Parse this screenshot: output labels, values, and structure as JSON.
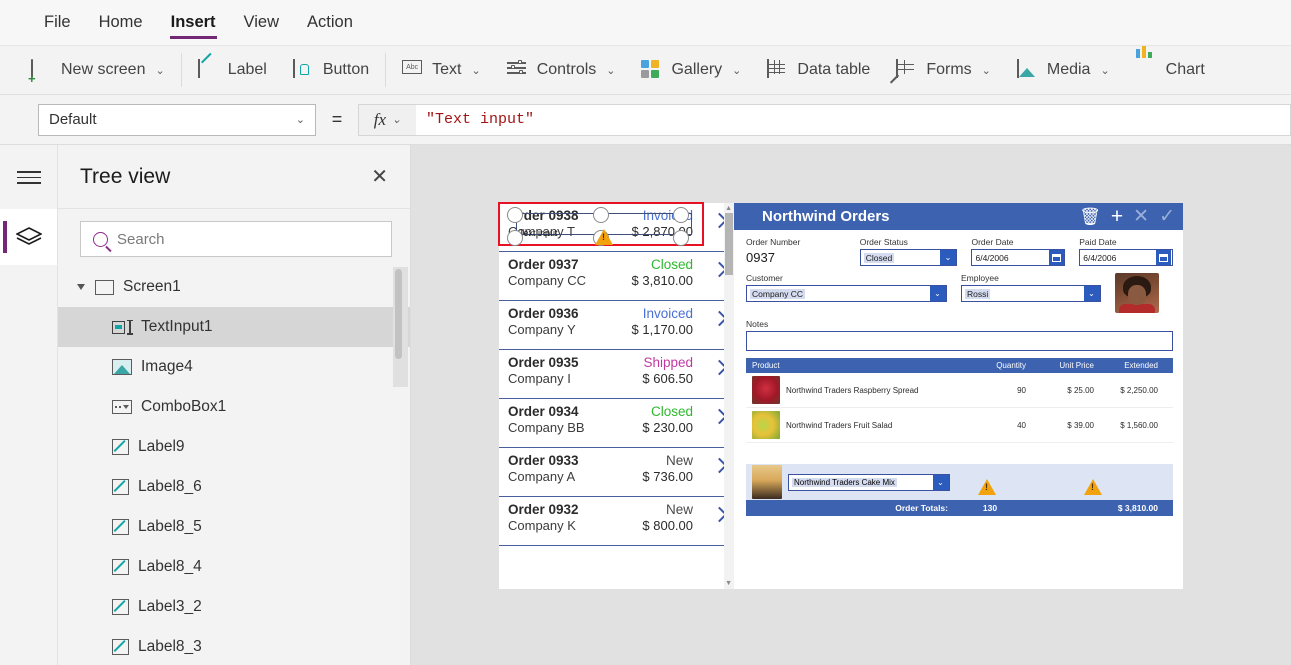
{
  "menu": {
    "tabs": [
      {
        "label": "File",
        "active": false
      },
      {
        "label": "Home",
        "active": false
      },
      {
        "label": "Insert",
        "active": true
      },
      {
        "label": "View",
        "active": false
      },
      {
        "label": "Action",
        "active": false
      }
    ]
  },
  "ribbon": {
    "items": [
      {
        "label": "New screen",
        "icon": "new-screen-icon",
        "caret": true
      },
      {
        "label": "Label",
        "icon": "label-icon",
        "caret": false
      },
      {
        "label": "Button",
        "icon": "button-icon",
        "caret": false
      },
      {
        "label": "Text",
        "icon": "text-icon",
        "caret": true
      },
      {
        "label": "Controls",
        "icon": "controls-icon",
        "caret": true
      },
      {
        "label": "Gallery",
        "icon": "gallery-icon",
        "caret": true
      },
      {
        "label": "Data table",
        "icon": "data-table-icon",
        "caret": false
      },
      {
        "label": "Forms",
        "icon": "forms-icon",
        "caret": true
      },
      {
        "label": "Media",
        "icon": "media-icon",
        "caret": true
      },
      {
        "label": "Chart",
        "icon": "chart-icon",
        "caret": false
      }
    ]
  },
  "propertybar": {
    "property": "Default",
    "equals": "=",
    "fx": "fx",
    "formula": "\"Text input\""
  },
  "treeview": {
    "title": "Tree view",
    "close_icon": "✕",
    "search_placeholder": "Search",
    "items": [
      {
        "label": "Screen1",
        "level": 0,
        "icon": "screen-icon",
        "selected": false
      },
      {
        "label": "TextInput1",
        "level": 1,
        "icon": "text-input-icon",
        "selected": true
      },
      {
        "label": "Image4",
        "level": 1,
        "icon": "image-icon",
        "selected": false
      },
      {
        "label": "ComboBox1",
        "level": 1,
        "icon": "combobox-icon",
        "selected": false
      },
      {
        "label": "Label9",
        "level": 1,
        "icon": "label-icon",
        "selected": false
      },
      {
        "label": "Label8_6",
        "level": 1,
        "icon": "label-icon",
        "selected": false
      },
      {
        "label": "Label8_5",
        "level": 1,
        "icon": "label-icon",
        "selected": false
      },
      {
        "label": "Label8_4",
        "level": 1,
        "icon": "label-icon",
        "selected": false
      },
      {
        "label": "Label3_2",
        "level": 1,
        "icon": "label-icon",
        "selected": false
      },
      {
        "label": "Label8_3",
        "level": 1,
        "icon": "label-icon",
        "selected": false
      }
    ]
  },
  "canvas": {
    "selection_label": "Text input",
    "gallery": [
      {
        "order": "Order 0938",
        "company": "Company T",
        "status": "Invoiced",
        "status_color": "#4a6fd4",
        "amount": "$ 2,870.00"
      },
      {
        "order": "Order 0937",
        "company": "Company CC",
        "status": "Closed",
        "status_color": "#2eb82e",
        "amount": "$ 3,810.00"
      },
      {
        "order": "Order 0936",
        "company": "Company Y",
        "status": "Invoiced",
        "status_color": "#4a6fd4",
        "amount": "$ 1,170.00"
      },
      {
        "order": "Order 0935",
        "company": "Company I",
        "status": "Shipped",
        "status_color": "#c0399f",
        "amount": "$ 606.50"
      },
      {
        "order": "Order 0934",
        "company": "Company BB",
        "status": "Closed",
        "status_color": "#2eb82e",
        "amount": "$ 230.00"
      },
      {
        "order": "Order 0933",
        "company": "Company A",
        "status": "New",
        "status_color": "#4a4a4a",
        "amount": "$ 736.00"
      },
      {
        "order": "Order 0932",
        "company": "Company K",
        "status": "New",
        "status_color": "#4a4a4a",
        "amount": "$ 800.00"
      }
    ],
    "detail": {
      "title": "Northwind Orders",
      "actions": [
        {
          "name": "delete-icon",
          "glyph": "🗑",
          "color": "#ffffff"
        },
        {
          "name": "add-icon",
          "glyph": "+",
          "color": "#ffffff"
        },
        {
          "name": "cancel-icon",
          "glyph": "✕",
          "color": "#9bb0d8"
        },
        {
          "name": "confirm-icon",
          "glyph": "✓",
          "color": "#9bb0d8"
        }
      ],
      "fields": {
        "order_number_label": "Order Number",
        "order_number_value": "0937",
        "order_status_label": "Order Status",
        "order_status_value": "Closed",
        "order_date_label": "Order Date",
        "order_date_value": "6/4/2006",
        "paid_date_label": "Paid Date",
        "paid_date_value": "6/4/2006",
        "customer_label": "Customer",
        "customer_value": "Company CC",
        "employee_label": "Employee",
        "employee_value": "Rossi",
        "notes_label": "Notes",
        "notes_value": ""
      },
      "products_table": {
        "headers": [
          "Product",
          "Quantity",
          "Unit Price",
          "Extended"
        ],
        "rows": [
          {
            "product": "Northwind Traders Raspberry Spread",
            "quantity": "90",
            "unit_price": "$ 25.00",
            "extended": "$ 2,250.00",
            "thumb": "raspberry-spread-thumb"
          },
          {
            "product": "Northwind Traders Fruit Salad",
            "quantity": "40",
            "unit_price": "$ 39.00",
            "extended": "$ 1,560.00",
            "thumb": "fruit-salad-thumb"
          }
        ],
        "new_row": {
          "product": "Northwind Traders Cake Mix",
          "thumb": "cake-mix-thumb"
        },
        "totals_label": "Order Totals:",
        "totals_quantity": "130",
        "totals_extended": "$ 3,810.00"
      }
    }
  },
  "colors": {
    "accent_purple": "#742774",
    "header_blue": "#3c62b0",
    "selection_red": "#e81123",
    "warning_amber": "#f2a20c",
    "canvas_bg": "#e1e1e1"
  }
}
